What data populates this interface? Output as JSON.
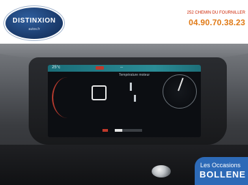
{
  "dealer": {
    "logo_text": "DISTINXION",
    "logo_sub": "autos.fr",
    "address": "252 CHEMIN DU FOURNILLER",
    "phone": "04.90.70.38.23"
  },
  "dashboard": {
    "topbar_left": "25°c",
    "topbar_right": "--",
    "center_title": "Température moteur",
    "center_line": "",
    "readout_left": "",
    "readout_mid": "",
    "readout_right": ""
  },
  "badge": {
    "line1": "Les Occasions",
    "line2": "BOLLENE"
  },
  "colors": {
    "brand_blue": "#2d6ab7",
    "phone_orange": "#e07a16",
    "address_red": "#cc2200",
    "screen_accent": "#2b8c96"
  }
}
